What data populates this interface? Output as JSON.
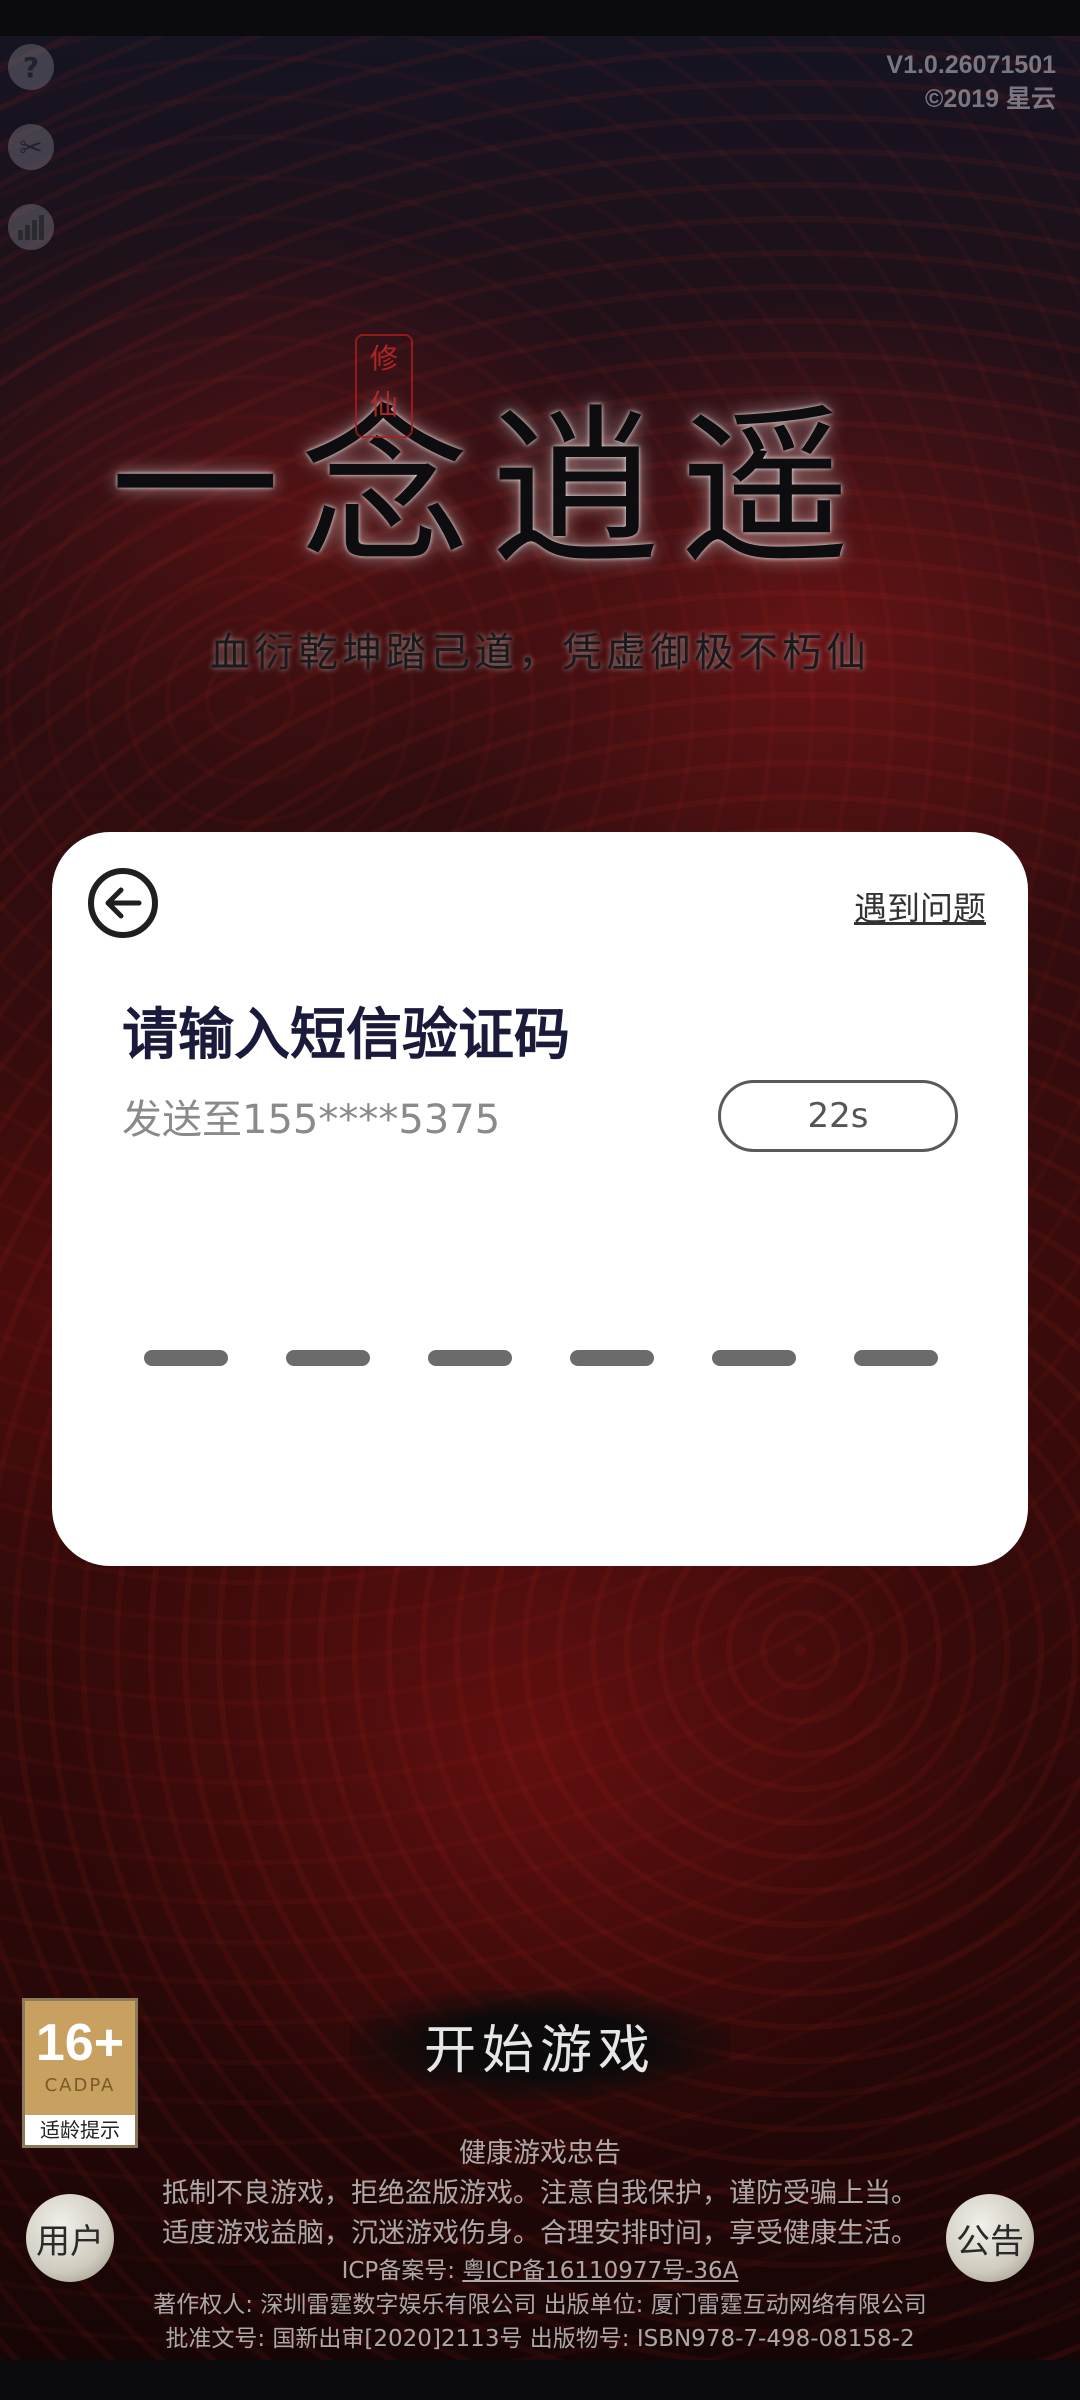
{
  "version": {
    "build": "V1.0.26071501",
    "copyright": "©2019 星云"
  },
  "side_icons": [
    {
      "name": "help-icon",
      "glyph": "?"
    },
    {
      "name": "tools-icon",
      "glyph": "✂"
    },
    {
      "name": "signal-icon",
      "glyph": "▮"
    }
  ],
  "logo": {
    "seal": "修仙",
    "title": "一念逍遥",
    "tagline": "血衍乾坤踏己道，凭虚御极不朽仙"
  },
  "dialog": {
    "help_label": "遇到问题",
    "title": "请输入短信验证码",
    "sent_to": "发送至155****5375",
    "countdown": "22s",
    "otp_length": 6
  },
  "start_button": {
    "label": "开始游戏"
  },
  "age_badge": {
    "rating": "16+",
    "org": "CADPA",
    "tip": "适龄提示"
  },
  "round_buttons": {
    "left": "用户",
    "right": "公告"
  },
  "footer": {
    "notice_title": "健康游戏忠告",
    "notice_line1": "抵制不良游戏，拒绝盗版游戏。注意自我保护，谨防受骗上当。",
    "notice_line2": "适度游戏益脑，沉迷游戏伤身。合理安排时间，享受健康生活。",
    "icp_label": "ICP备案号: ",
    "icp_value": "粤ICP备16110977号-36A",
    "copyright_line": "著作权人: 深圳雷霆数字娱乐有限公司 出版单位: 厦门雷霆互动网络有限公司",
    "approval_line": "批准文号: 国新出审[2020]2113号 出版物号: ISBN978-7-498-08158-2"
  },
  "colors": {
    "dialog_bg": "#ffffff",
    "title_color": "#1a1a3a",
    "subtext_color": "#8a8a8a",
    "otp_slot_color": "#6b6b6b"
  }
}
